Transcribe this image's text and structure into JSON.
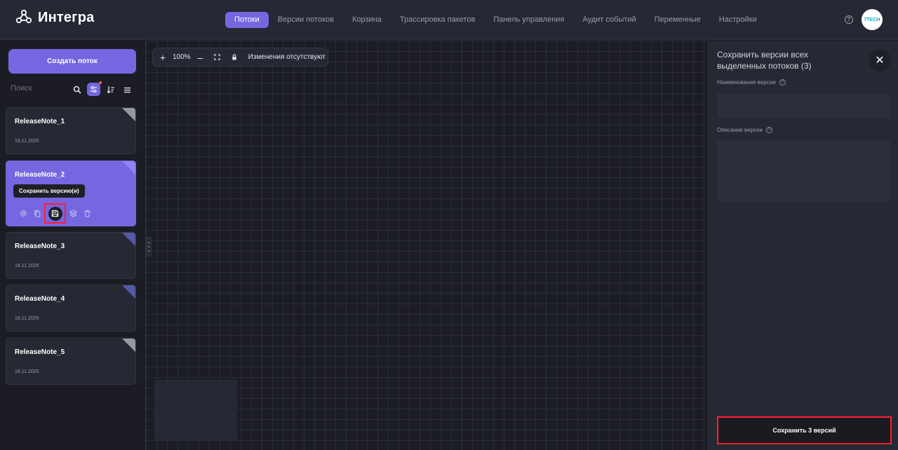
{
  "app": {
    "name": "Интегра",
    "avatar_text": "7TECH"
  },
  "nav": {
    "items": [
      {
        "label": "Потоки",
        "active": true
      },
      {
        "label": "Версии потоков",
        "active": false
      },
      {
        "label": "Корзина",
        "active": false
      },
      {
        "label": "Трассировка пакетов",
        "active": false
      },
      {
        "label": "Панель управления",
        "active": false
      },
      {
        "label": "Аудит событий",
        "active": false
      },
      {
        "label": "Переменные",
        "active": false
      },
      {
        "label": "Настройки",
        "active": false
      }
    ]
  },
  "sidebar": {
    "create_label": "Создать поток",
    "search_placeholder": "Поиск",
    "cards": [
      {
        "title": "ReleaseNote_1",
        "date": "18.11.2025"
      },
      {
        "title": "ReleaseNote_2",
        "tooltip": "Сохранить версию(и)"
      },
      {
        "title": "ReleaseNote_3",
        "date": "18.11.2025"
      },
      {
        "title": "ReleaseNote_4",
        "date": "18.11.2025"
      },
      {
        "title": "ReleaseNote_5",
        "date": "18.11.2025"
      }
    ]
  },
  "canvas": {
    "zoom": "100%",
    "status": "Изменения отсутствуют"
  },
  "panel": {
    "title": "Сохранить версии всех выделенных потоков (3)",
    "version_name_label": "Наименование версии",
    "version_name_value": "",
    "description_label": "Описание версии",
    "description_value": "",
    "save_label": "Сохранить 3 версий"
  },
  "colors": {
    "accent": "#7567e0",
    "background": "#1c1d24",
    "panel": "#262833",
    "highlight": "#ff1f2d"
  }
}
